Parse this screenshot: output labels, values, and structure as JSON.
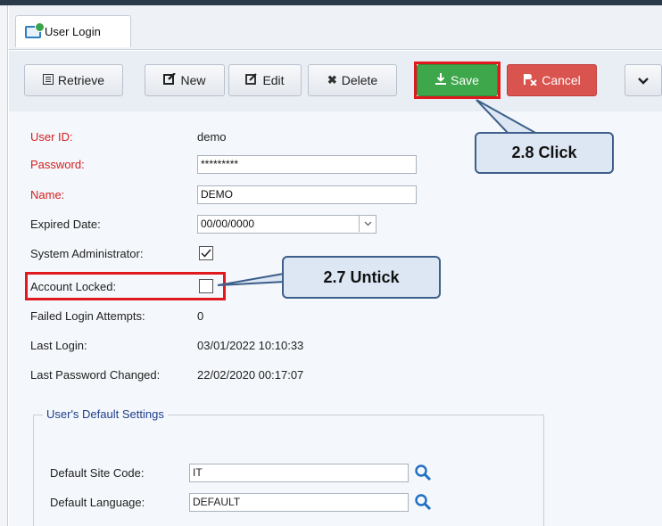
{
  "tab": {
    "label": "User Login",
    "icon": "user-login-tab-icon"
  },
  "toolbar": {
    "retrieve_label": "Retrieve",
    "new_label": "New",
    "edit_label": "Edit",
    "delete_label": "Delete",
    "save_label": "Save",
    "cancel_label": "Cancel"
  },
  "form": {
    "user_id_label": "User ID:",
    "user_id_value": "demo",
    "password_label": "Password:",
    "password_value": "*********",
    "name_label": "Name:",
    "name_value": "DEMO",
    "expired_date_label": "Expired Date:",
    "expired_date_value": "00/00/0000",
    "sysadmin_label": "System Administrator:",
    "sysadmin_checked": true,
    "account_locked_label": "Account Locked:",
    "account_locked_checked": false,
    "failed_attempts_label": "Failed Login Attempts:",
    "failed_attempts_value": "0",
    "last_login_label": "Last Login:",
    "last_login_value": "03/01/2022 10:10:33",
    "last_pw_changed_label": "Last Password Changed:",
    "last_pw_changed_value": "22/02/2020 00:17:07"
  },
  "defaults": {
    "group_title": "User's Default Settings",
    "site_code_label": "Default Site Code:",
    "site_code_value": "IT",
    "language_label": "Default Language:",
    "language_value": "DEFAULT"
  },
  "callouts": {
    "click": "2.8 Click",
    "untick": "2.7 Untick"
  },
  "colors": {
    "save": "#3ea64b",
    "cancel": "#d9534f",
    "required_label": "#d42020",
    "highlight": "#e0191f",
    "callout_fill": "#dde7f3",
    "callout_border": "#3d5f8a"
  }
}
